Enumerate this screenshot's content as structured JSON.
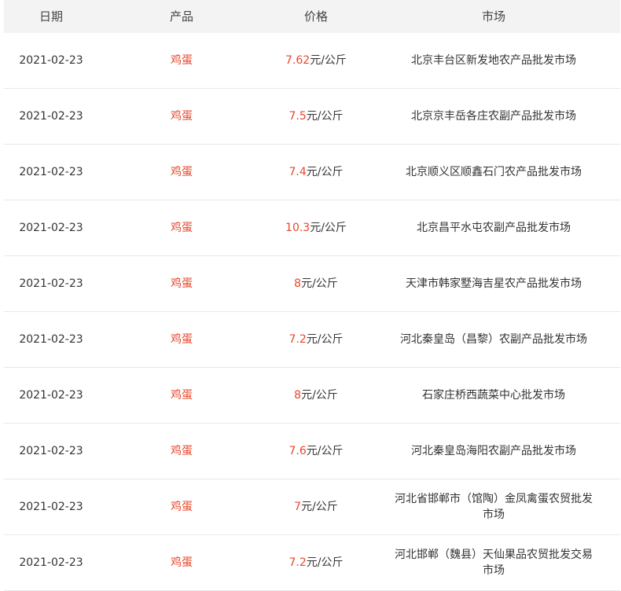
{
  "columns": {
    "date": "日期",
    "product": "产品",
    "price": "价格",
    "market": "市场"
  },
  "rows": [
    {
      "date": "2021-02-23",
      "product": "鸡蛋",
      "price": "7.62",
      "unit": "元/公斤",
      "market": "北京丰台区新发地农产品批发市场"
    },
    {
      "date": "2021-02-23",
      "product": "鸡蛋",
      "price": "7.5",
      "unit": "元/公斤",
      "market": "北京京丰岳各庄农副产品批发市场"
    },
    {
      "date": "2021-02-23",
      "product": "鸡蛋",
      "price": "7.4",
      "unit": "元/公斤",
      "market": "北京顺义区顺鑫石门农产品批发市场"
    },
    {
      "date": "2021-02-23",
      "product": "鸡蛋",
      "price": "10.3",
      "unit": "元/公斤",
      "market": "北京昌平水屯农副产品批发市场"
    },
    {
      "date": "2021-02-23",
      "product": "鸡蛋",
      "price": "8",
      "unit": "元/公斤",
      "market": "天津市韩家墅海吉星农产品批发市场"
    },
    {
      "date": "2021-02-23",
      "product": "鸡蛋",
      "price": "7.2",
      "unit": "元/公斤",
      "market": "河北秦皇岛（昌黎）农副产品批发市场"
    },
    {
      "date": "2021-02-23",
      "product": "鸡蛋",
      "price": "8",
      "unit": "元/公斤",
      "market": "石家庄桥西蔬菜中心批发市场"
    },
    {
      "date": "2021-02-23",
      "product": "鸡蛋",
      "price": "7.6",
      "unit": "元/公斤",
      "market": "河北秦皇岛海阳农副产品批发市场"
    },
    {
      "date": "2021-02-23",
      "product": "鸡蛋",
      "price": "7",
      "unit": "元/公斤",
      "market": "河北省邯郸市（馆陶）金凤禽蛋农贸批发市场"
    },
    {
      "date": "2021-02-23",
      "product": "鸡蛋",
      "price": "7.2",
      "unit": "元/公斤",
      "market": "河北邯郸（魏县）天仙果品农贸批发交易市场"
    }
  ],
  "colors": {
    "accent": "#e8472c",
    "header_bg": "#f3f3f3",
    "row_border": "#e8e8e8"
  }
}
